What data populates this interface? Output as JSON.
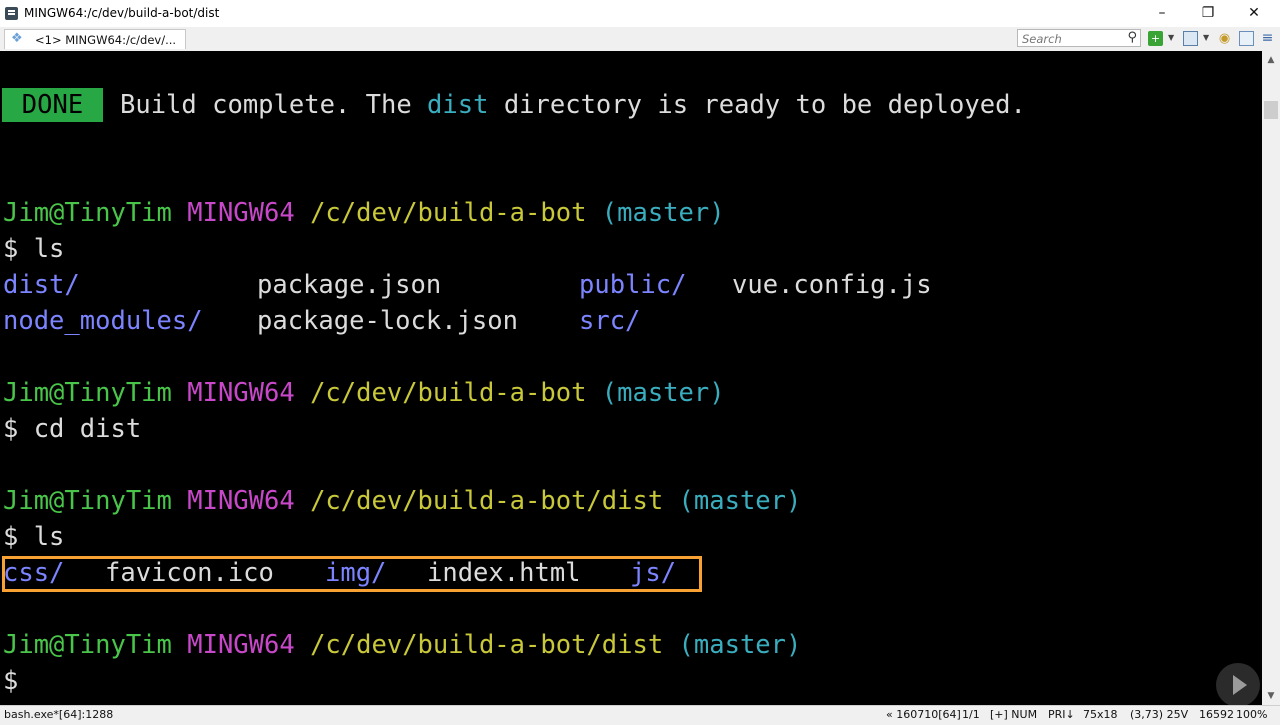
{
  "window": {
    "title": "MINGW64:/c/dev/build-a-bot/dist",
    "controls": {
      "minimize": "–",
      "maximize": "❐",
      "close": "✕"
    }
  },
  "toolbar": {
    "tab_label": "<1> MINGW64:/c/dev/...",
    "search_placeholder": "Search"
  },
  "console": {
    "done_badge": "DONE",
    "build_msg_1": "Build complete. The ",
    "build_msg_dist": "dist",
    "build_msg_2": " directory is ready to be deployed.",
    "prompts": [
      {
        "user": "Jim@TinyTim",
        "shell": "MINGW64",
        "path": "/c/dev/build-a-bot",
        "branch": "(master)"
      },
      {
        "user": "Jim@TinyTim",
        "shell": "MINGW64",
        "path": "/c/dev/build-a-bot",
        "branch": "(master)"
      },
      {
        "user": "Jim@TinyTim",
        "shell": "MINGW64",
        "path": "/c/dev/build-a-bot/dist",
        "branch": "(master)"
      },
      {
        "user": "Jim@TinyTim",
        "shell": "MINGW64",
        "path": "/c/dev/build-a-bot/dist",
        "branch": "(master)"
      }
    ],
    "commands": [
      "$ ls",
      "$ cd dist",
      "$ ls",
      "$"
    ],
    "ls1_row1": [
      "dist/",
      "package.json",
      "public/",
      "vue.config.js"
    ],
    "ls1_row2": [
      "node_modules/",
      "package-lock.json",
      "src/"
    ],
    "ls2": [
      "css/",
      "favicon.ico",
      "img/",
      "index.html",
      "js/"
    ],
    "highlight_color": "#f7a233"
  },
  "statusbar": {
    "left": "bash.exe*[64]:1288",
    "items": [
      "« 160710[64]",
      "1/1",
      "[+] NUM",
      "PRI↓",
      "75x18",
      "(3,73) 25V",
      "16592",
      "100%"
    ]
  }
}
